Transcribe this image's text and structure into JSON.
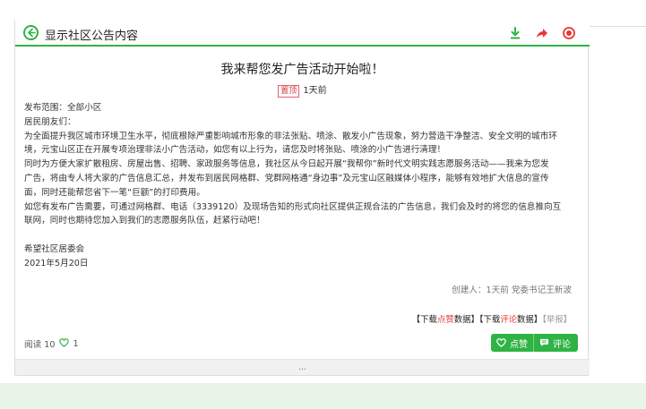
{
  "header": {
    "title": "显示社区公告内容",
    "icons": [
      "back-icon",
      "download-icon",
      "share-icon",
      "record-icon"
    ],
    "accent_color": "#2fb344",
    "danger_color": "#e53935"
  },
  "article": {
    "title": "我来帮您发广告活动开始啦！",
    "tag": "置顶",
    "time": "1天前",
    "lines": [
      "发布范围：全部小区",
      "居民朋友们：",
      "为全面提升我区城市环境卫生水平，彻底根除严重影响城市形象的非法张贴、喷涂、散发小广告现象，努力营造干净整洁、安全文明的城市环",
      "境，元宝山区正在开展专项治理非法小广告活动，如您有以上行为，请您及时将张贴、喷涂的小广告进行清理！",
      "同时为方便大家扩散租房、房屋出售、招聘、家政服务等信息，我社区从今日起开展“我帮你”新时代文明实践志愿服务活动——我来为您发",
      "广告，将由专人将大家的广告信息汇总，并发布到居民网格群、党群网格通“身边事”及元宝山区融媒体小程序，能够有效地扩大信息的宣传",
      "面，同时还能帮您省下一笔“巨额”的打印费用。",
      "如您有发布广告需要，可通过网格群、电话（3339120）及现场告知的形式向社区提供正规合法的广告信息，我们会及时的将您的信息推向互",
      "联网，同时也期待您加入到我们的志愿服务队伍，赶紧行动吧！",
      "",
      "希望社区居委会",
      "2021年5月20日"
    ]
  },
  "creator": "创建人：1天前 党委书记王新波",
  "downloads": {
    "open1": "【下载",
    "like_word": "点赞",
    "close1": "数据】",
    "open2": "【下载",
    "comment_word": "评论",
    "close2": "数据】",
    "report": "【举报】"
  },
  "stats": {
    "reads_label": "阅读 10",
    "likes": "1"
  },
  "actions": {
    "like_label": "点赞",
    "comment_label": "评论"
  },
  "footer": {
    "more": "..."
  }
}
